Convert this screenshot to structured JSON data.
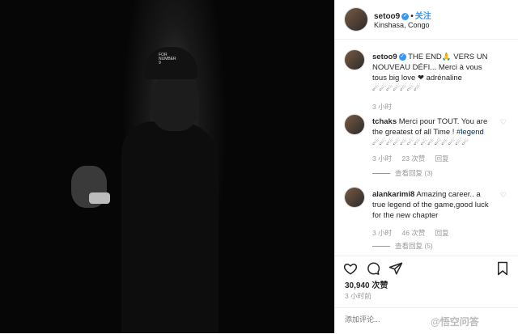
{
  "header": {
    "username": "setoo9",
    "follow": "关注",
    "separator": "•",
    "location": "Kinshasa, Congo"
  },
  "photo": {
    "cap_text": "FOR NUMBER 9"
  },
  "caption": {
    "username": "setoo9",
    "text": "THE END🙏 VERS UN NOUVEAU DÉFI... Merci à vous tous big love ❤ adrénaline ☄☄☄☄☄☄☄",
    "time": "3 小时"
  },
  "comments": [
    {
      "username": "tchaks",
      "text": "Merci pour TOUT. You are the greatest of all Time ! ",
      "hashtag": "#legend",
      "extra": "☄☄☄☄☄☄☄☄☄☄☄☄☄☄",
      "time": "3 小时",
      "likes": "23 次赞",
      "reply": "回复",
      "view_replies": "查看回复 (3)",
      "heart": "♡"
    },
    {
      "username": "alankarimi8",
      "text": "Amazing career.. a true legend of the game,good luck for the new chapter",
      "time": "3 小时",
      "likes": "46 次赞",
      "reply": "回复",
      "view_replies": "查看回复 (5)",
      "heart": "♡"
    }
  ],
  "actions": {
    "like_icon": "heart-outline-icon",
    "comment_icon": "comment-bubble-icon",
    "share_icon": "share-arrow-icon",
    "save_icon": "bookmark-icon"
  },
  "likes": "30,940 次赞",
  "time": "3 小时前",
  "comment_input": {
    "placeholder": "添加评论..."
  },
  "watermark": "@悟空问答",
  "colors": {
    "accent": "#3897f0",
    "text": "#262626",
    "muted": "#999999",
    "photo_bg": "#060606"
  }
}
